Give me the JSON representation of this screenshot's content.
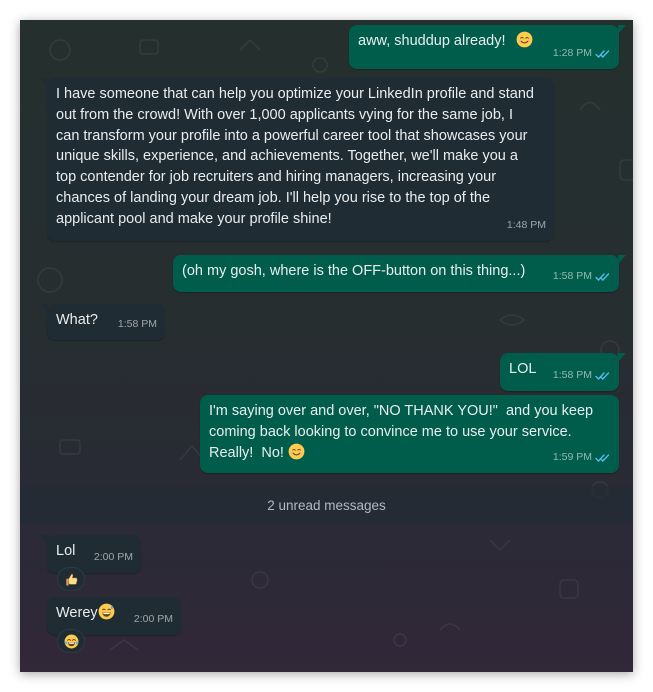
{
  "unread": {
    "label": "2 unread messages"
  },
  "messages": [
    {
      "direction": "out",
      "text": "aww, shuddup already!",
      "emoji": "smiling-face",
      "time": "1:28 PM",
      "status": "read"
    },
    {
      "direction": "in",
      "text": "I have someone that can help you optimize your LinkedIn profile and stand out from the crowd! With over 1,000 applicants vying for the same job, I can transform your profile into a powerful career tool that showcases your unique skills, experience, and achievements. Together, we'll make you a top contender for job recruiters and hiring managers, increasing your chances of landing your dream job. I'll help you rise to the top of the applicant pool and make your profile shine!",
      "time": "1:48 PM"
    },
    {
      "direction": "out",
      "text": "(oh my gosh, where is the OFF-button on this thing...)",
      "time": "1:58 PM",
      "status": "read"
    },
    {
      "direction": "in",
      "text": "What?",
      "time": "1:58 PM"
    },
    {
      "direction": "out",
      "text": "LOL",
      "time": "1:58 PM",
      "status": "read"
    },
    {
      "direction": "out",
      "text": "I'm saying over and over, \"NO THANK YOU!\"  and you keep coming back looking to convince me to use your service. Really!  No! ",
      "emoji": "smiling-face",
      "time": "1:59 PM",
      "status": "read"
    },
    {
      "direction": "in",
      "text": "Lol",
      "time": "2:00 PM",
      "reaction": "thumbs-up"
    },
    {
      "direction": "in",
      "text": "Werey",
      "emoji": "grinning-sweat-face",
      "time": "2:00 PM",
      "reaction": "tears-of-joy-face"
    }
  ],
  "colors": {
    "outgoing_bubble": "#005c4b",
    "incoming_bubble": "#202c33",
    "read_ticks": "#53bdeb",
    "text": "#e9edef"
  }
}
